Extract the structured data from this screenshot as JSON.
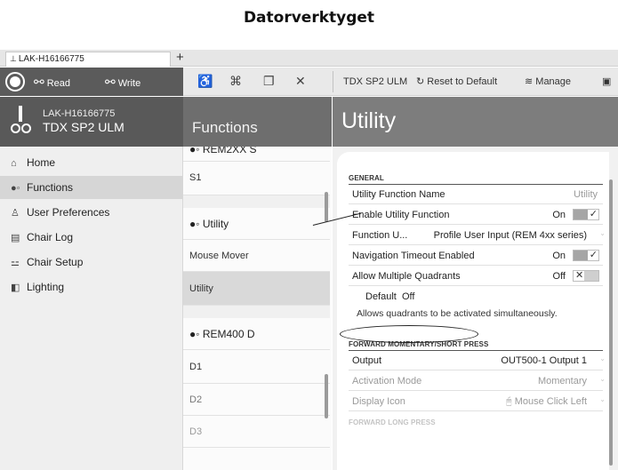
{
  "caption": "Datorverktyget",
  "tab": {
    "label": "LAK-H16166775",
    "add": "+"
  },
  "toolbar": {
    "read": "Read",
    "write": "Write",
    "device_label": "TDX SP2 ULM",
    "reset": "Reset to Default",
    "manage": "Manage"
  },
  "device": {
    "id": "LAK-H16166775",
    "model": "TDX SP2 ULM"
  },
  "headers": {
    "functions": "Functions",
    "utility": "Utility"
  },
  "sidebar": {
    "items": [
      {
        "label": "Home",
        "icon": "home-icon"
      },
      {
        "label": "Functions",
        "icon": "functions-icon"
      },
      {
        "label": "User Preferences",
        "icon": "user-icon"
      },
      {
        "label": "Chair Log",
        "icon": "log-icon"
      },
      {
        "label": "Chair Setup",
        "icon": "setup-icon"
      },
      {
        "label": "Lighting",
        "icon": "lighting-icon"
      }
    ]
  },
  "functions_list": {
    "rem2xx_header": "REM2XX S",
    "s1": "S1",
    "utility_header": "Utility",
    "mouse_mover": "Mouse Mover",
    "utility": "Utility",
    "rem400_header": "REM400 D",
    "d1": "D1",
    "d2": "D2",
    "d3": "D3"
  },
  "general": {
    "title": "GENERAL",
    "rows": [
      {
        "label": "Utility Function Name",
        "value": "Utility"
      },
      {
        "label": "Enable Utility Function",
        "value": "On"
      },
      {
        "label": "Function U...",
        "value": "Profile User Input (REM 4xx series)"
      },
      {
        "label": "Navigation Timeout Enabled",
        "value": "On"
      },
      {
        "label": "Allow Multiple Quadrants",
        "value": "Off"
      }
    ],
    "default_label": "Default",
    "default_value": "Off",
    "description": "Allows quadrants to be activated simultaneously."
  },
  "forward_momentary": {
    "title": "FORWARD MOMENTARY/SHORT PRESS",
    "rows": [
      {
        "label": "Output",
        "value": "OUT500-1 Output 1"
      },
      {
        "label": "Activation Mode",
        "value": "Momentary"
      },
      {
        "label": "Display Icon",
        "value": "Mouse Click Left"
      }
    ]
  },
  "forward_long": {
    "title": "FORWARD LONG PRESS"
  },
  "colors": {
    "sidebar_dark": "#595959",
    "utility_header": "#7d7d7d",
    "functions_header": "#6e6e6e"
  }
}
